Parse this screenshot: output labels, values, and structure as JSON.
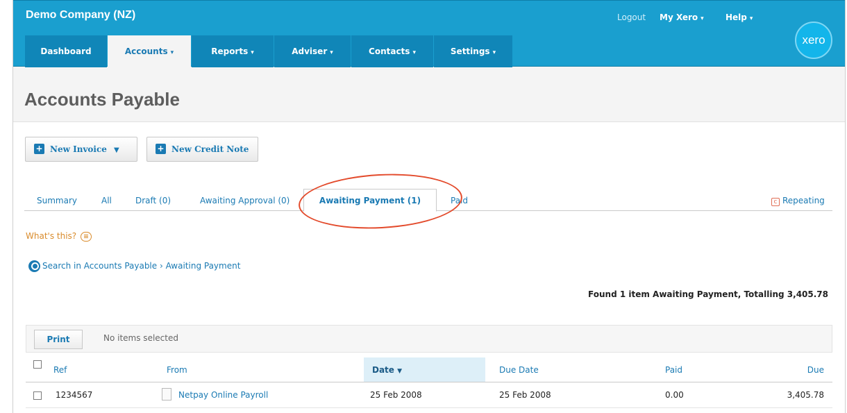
{
  "header": {
    "company": "Demo Company (NZ)",
    "logout": "Logout",
    "my_xero": "My Xero",
    "help": "Help",
    "logo": "xero",
    "nav": [
      {
        "label": "Dashboard",
        "caret": ""
      },
      {
        "label": "Accounts",
        "caret": "▾"
      },
      {
        "label": "Reports",
        "caret": "▾"
      },
      {
        "label": "Adviser",
        "caret": "▾"
      },
      {
        "label": "Contacts",
        "caret": "▾"
      },
      {
        "label": "Settings",
        "caret": "▾"
      }
    ],
    "active_nav": "Accounts"
  },
  "page": {
    "title": "Accounts Payable",
    "new_invoice": "New Invoice",
    "new_credit_note": "New Credit Note",
    "tabs": [
      "Summary",
      "All",
      "Draft (0)",
      "Awaiting Approval (0)",
      "Awaiting Payment (1)",
      "Paid"
    ],
    "active_tab": "Awaiting Payment (1)",
    "repeating": "Repeating",
    "whats_this": "What's this?",
    "search_link": "Search in Accounts Payable › Awaiting Payment",
    "found_summary": "Found 1 item Awaiting Payment, Totalling 3,405.78"
  },
  "table": {
    "print": "Print",
    "selection_status": "No items selected",
    "columns": [
      "Ref",
      "From",
      "Date",
      "Due Date",
      "Paid",
      "Due"
    ],
    "sort_column": "Date",
    "sort_indicator": "▼",
    "rows": [
      {
        "ref": "1234567",
        "from": "Netpay Online Payroll",
        "date": "25 Feb 2008",
        "due_date": "25 Feb 2008",
        "paid": "0.00",
        "due": "3,405.78"
      }
    ]
  },
  "colors": {
    "header_blue": "#1a9fcf",
    "nav_blue": "#1086b8",
    "link_blue": "#1a7ab3",
    "annotation_red": "#e34a2b",
    "help_orange": "#d98b2b"
  }
}
